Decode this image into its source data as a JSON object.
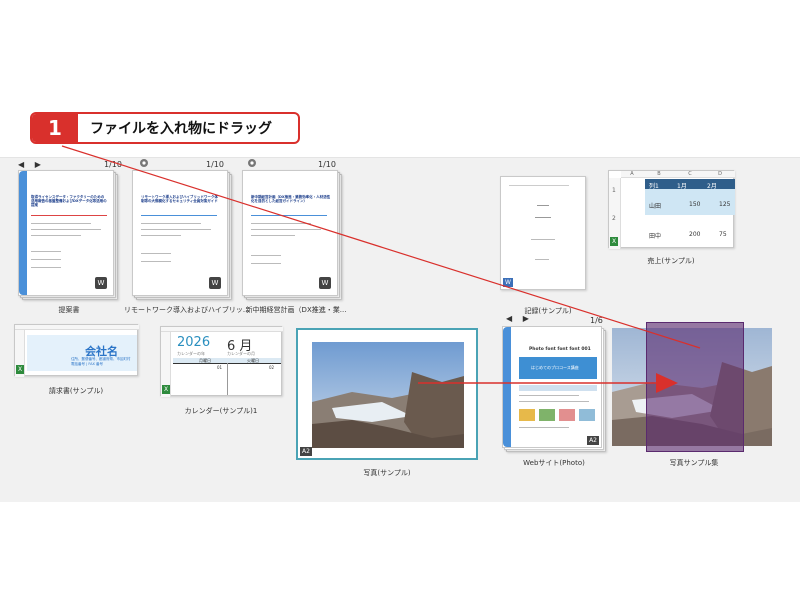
{
  "callout": {
    "number": "1",
    "text": "ファイルを入れ物にドラッグ"
  },
  "nav": {
    "arrows": "◀ ▶"
  },
  "items": {
    "proposal": {
      "label": "提案書",
      "pages": "1/10",
      "title": "取得ライセンスデータ・ファクタリーのための活用報告の基盤整備およびDXデータ化等活用の提案",
      "date": "2025年5月"
    },
    "remote": {
      "label": "リモートワーク導入およびハイブリッ...",
      "pages": "1/10",
      "title": "リモートワーク導入およびハイブリッドワーク体制等の大規模化するセキュリティ全員対策ガイド"
    },
    "plan": {
      "label": "新中期経営計画（DX推進・業...",
      "pages": "1/10",
      "title": "新中期経営計画（DX推進・業務効率化・人材活性化を目的とした経営ガイドライン）"
    },
    "record": {
      "label": "記録(サンプル)"
    },
    "sales": {
      "label": "売上(サンプル)",
      "cols": [
        "A",
        "B",
        "C",
        "D"
      ],
      "rows": [
        "1",
        "2"
      ],
      "header": [
        "列1",
        "1月",
        "2月"
      ],
      "r1": [
        "山田",
        "150",
        "125"
      ],
      "r2": [
        "田中",
        "200",
        "75"
      ]
    },
    "invoice": {
      "label": "請求書(サンプル)",
      "company": "会社名",
      "address": "住所、郵便番号、都道府県、市区町村",
      "phone": "電話番号 | FAX 番号"
    },
    "calendar": {
      "label": "カレンダー(サンプル)1",
      "year": "2026",
      "month": "6 月",
      "year_caption": "カレンダーの年",
      "month_caption": "カレンダーの月",
      "day1": "月曜日",
      "day2": "火曜日",
      "d1": "01",
      "d2": "02"
    },
    "photo": {
      "label": "写真(サンプル)",
      "tag": "A2"
    },
    "website": {
      "label": "Webサイト(Photo)",
      "pages": "1/6",
      "tag": "A2",
      "headline": "Photo font font font 001",
      "banner": "はじめてのプロコース講座"
    },
    "photo_bundle": {
      "label": "写真サンプル集"
    }
  },
  "colors": {
    "accent_red": "#d9302c",
    "doc_spine": "#4a90d9",
    "photo_frame": "#4aa3b5",
    "drop_overlay": "#6a3c78"
  }
}
